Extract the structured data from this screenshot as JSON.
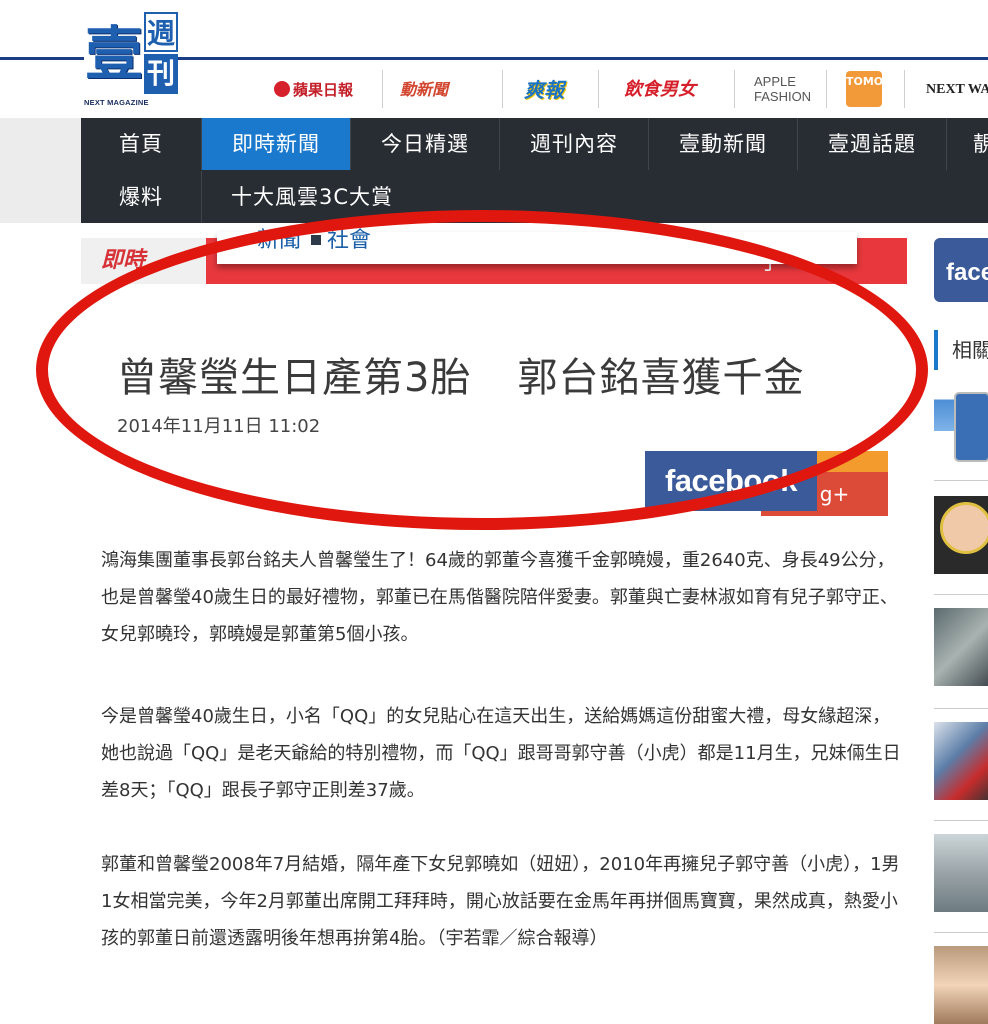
{
  "header": {
    "logo": {
      "big_char": "壹",
      "small_top": "週",
      "small_bottom": "刊",
      "tagline": "NEXT MAGAZINE"
    },
    "brands": [
      {
        "name": "蘋果日報",
        "color": "#c4202a"
      },
      {
        "name": "動新聞",
        "color": "#d2452f"
      },
      {
        "name": "爽報",
        "color": "#1b73c4"
      },
      {
        "name": "飲食男女",
        "color": "#d6202b"
      },
      {
        "name": "APPLE FASHION",
        "color": "#555555"
      },
      {
        "name": "TOMO NEWS",
        "color": "#f2993a"
      },
      {
        "name": "NEXT WATCH 靚",
        "color": "#222222"
      }
    ]
  },
  "nav": {
    "row1": [
      "首頁",
      "即時新聞",
      "今日精選",
      "週刊內容",
      "壹動新聞",
      "壹週話題",
      "靚"
    ],
    "row2": [
      "爆料",
      "十大風雲3C大賞"
    ],
    "active": "即時新聞",
    "active_color": "#1a79cc"
  },
  "article": {
    "section_logo": "即時",
    "breadcrumb": [
      "新聞",
      "社會"
    ],
    "topbar_right": "了",
    "title_part1": "曾馨瑩生日產第3胎",
    "title_part2": "郭台銘喜獲千金",
    "date": "2014年11月11日 11:02",
    "share": {
      "facebook": "facebook",
      "gplus": "g+"
    },
    "paragraphs": [
      "鴻海集團董事長郭台銘夫人曾馨瑩生了！64歲的郭董今喜獲千金郭曉嫚，重2640克、身長49公分，也是曾馨瑩40歲生日的最好禮物，郭董已在馬偕醫院陪伴愛妻。郭董與亡妻林淑如育有兒子郭守正、女兒郭曉玲，郭曉嫚是郭董第5個小孩。",
      "今是曾馨瑩40歲生日，小名「QQ」的女兒貼心在這天出生，送給媽媽這份甜蜜大禮，母女緣超深，她也說過「QQ」是老天爺給的特別禮物，而「QQ」跟哥哥郭守善（小虎）都是11月生，兄妹倆生日差8天；「QQ」跟長子郭守正則差37歲。",
      "郭董和曾馨瑩2008年7月結婚，隔年產下女兒郭曉如（妞妞），2010年再擁兒子郭守善（小虎），1男1女相當完美，今年2月郭董出席開工拜拜時，開心放話要在金馬年再拼個馬寶寶，果然成真，熱愛小孩的郭董日前還透露明後年想再拚第4胎。（宇若霏／綜合報導）"
    ],
    "highlight_color": "#e0170f"
  },
  "sidebar": {
    "facebook_label": "face",
    "related_label": "相關"
  }
}
